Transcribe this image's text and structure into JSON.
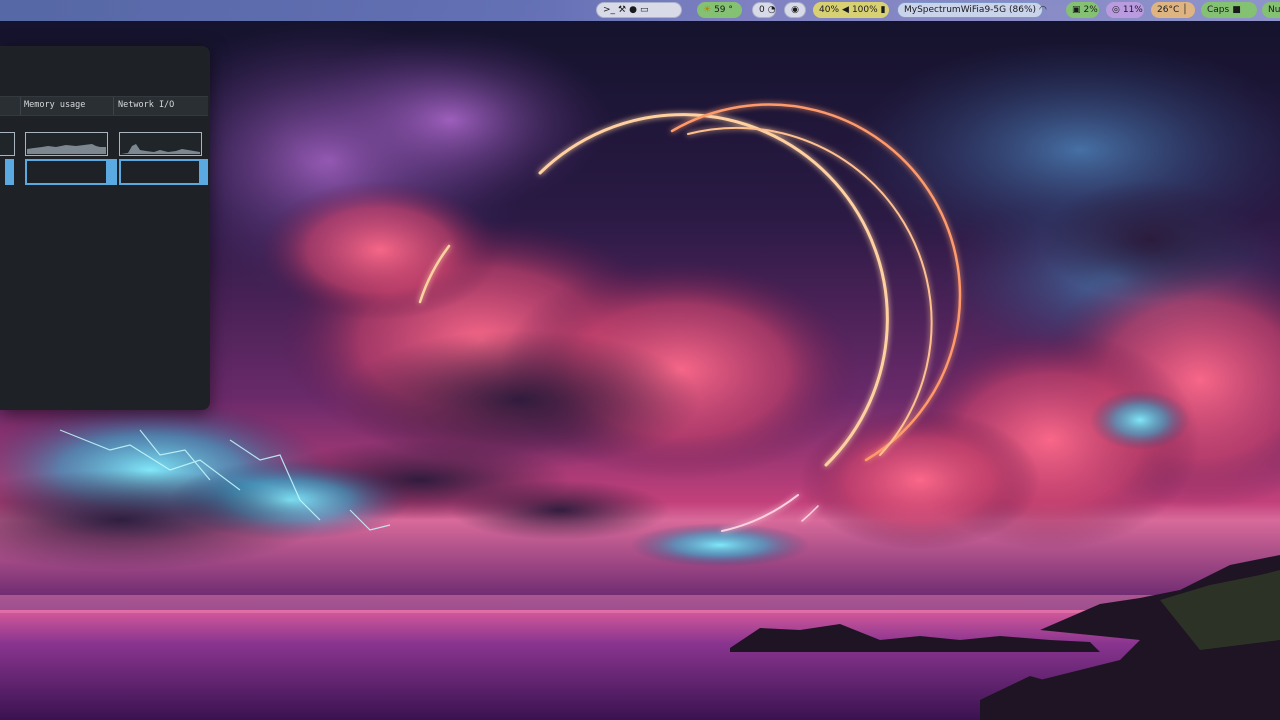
{
  "topbar": {
    "launcher_icons": [
      "terminal-icon",
      "tools-icon",
      "chat-icon",
      "monitor-icon"
    ],
    "weather": {
      "icon": "sun-icon",
      "temp": "59 °"
    },
    "notifications": {
      "count": "0",
      "icon": "bell-icon"
    },
    "visibility": {
      "icon": "eye-icon"
    },
    "brightness": "40%",
    "volume": {
      "icon": "speaker-icon",
      "level": "100%",
      "mic_icon": "microphone-icon"
    },
    "wifi": {
      "label": "MySpectrumWiFia9-5G (86%)",
      "icon": "wifi-icon"
    },
    "cpu": {
      "icon": "cpu-icon",
      "value": "2%"
    },
    "memory": {
      "icon": "memory-icon",
      "value": "11%"
    },
    "temperature": {
      "value": "26°C",
      "icon": "thermometer-icon"
    },
    "caps": {
      "label": "Caps",
      "icon": "lock-icon"
    },
    "num": {
      "label": "Nu"
    }
  },
  "monitor": {
    "columns": [
      "Memory usage",
      "Network I/O"
    ]
  },
  "colors": {
    "selection": "#5aa9e0",
    "window_bg": "#1e2226",
    "neon_ring": "#ffb070"
  }
}
